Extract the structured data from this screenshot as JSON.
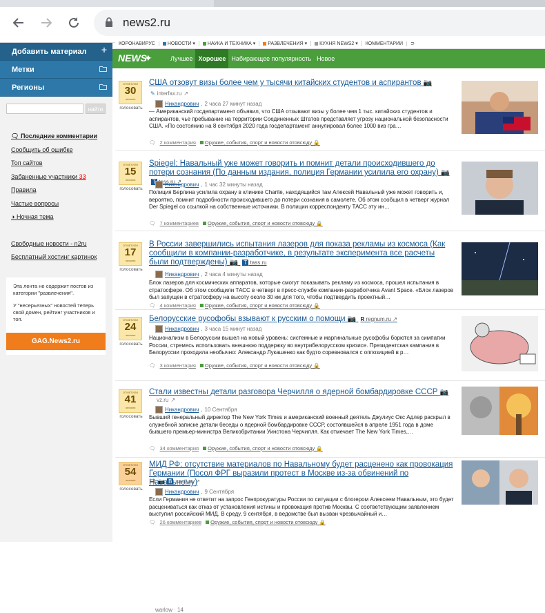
{
  "browser": {
    "url": "news2.ru"
  },
  "sidebar": {
    "add_label": "Добавить материал",
    "tags_label": "Метки",
    "regions_label": "Регионы",
    "search_button": "найти",
    "links": [
      {
        "label": "Последние комментарии"
      },
      {
        "label": "Сообщить об ошибке"
      },
      {
        "label": "Топ сайтов"
      },
      {
        "label": "Забаненные участники",
        "badge": "33"
      },
      {
        "label": "Правила"
      },
      {
        "label": "Частые вопросы"
      },
      {
        "label": "Ночная тема"
      }
    ],
    "links2": [
      {
        "label": "Свободные новости - n2ru"
      },
      {
        "label": "Бесплатный хостинг картинок"
      }
    ],
    "note1": "Эта лента не содержит постов из категории \"развлечения\".",
    "note2": "У \"несерьезных\" новостей теперь свой домен, рейтинг участников и топ.",
    "gag_label": "GAG.News2.ru"
  },
  "topnav": {
    "items": [
      "КОРОНАВИРУС",
      "НОВОСТИ ▾",
      "НАУКА И ТЕХНИКА ▾",
      "РАЗВЛЕЧЕНИЯ ▾",
      "КУХНЯ NEWS2 ▾",
      "КОММЕНТАРИИ"
    ]
  },
  "greenbar": {
    "logo": "NEWS",
    "tabs": [
      "Лучшее",
      "Хорошее",
      "Набирающее популярность",
      "Новое"
    ]
  },
  "posts": [
    {
      "votes": "30",
      "vote_top": "ОТМЕТИЛИ",
      "vote_bottom": "человек",
      "vote_label": "голосовать",
      "title": "США отзовут визы более чем у тысячи китайских студентов и аспирантов",
      "source": "interfax.ru",
      "author": "Никандрович",
      "time": "2 часа 27 минут назад",
      "body": "— Американский госдепартамент объявил, что США отзывают визы у более чем 1 тыс. китайских студентов и аспирантов, чье пребывание на территории Соединенных Штатов представляет угрозу национальной безопасности США.  «По состоянию на 8 сентября 2020 года госдепартамент аннулировал более 1000 виз гра…",
      "comments": "2 комментария",
      "tag": "Оружие, события, спорт и новости отовсюду"
    },
    {
      "votes": "15",
      "vote_top": "ОТМЕТИЛИ",
      "vote_bottom": "человек",
      "vote_label": "голосовать",
      "title": "Spiegel: Навальный уже может говорить и помнит детали происходившего до потери сознания (По данным издания, полиция Германии усилила его охрану)",
      "source": "tass.ru",
      "author": "Никандрович",
      "time": "1 час 32 минуты назад",
      "body": "Полиция Берлина усилила охрану в клинике Charite, находящийся там Алексей Навальный уже может говорить и, вероятно, помнит подробности происходившего до потери сознания в самолете. Об этом сообщил в четверг журнал Der Spiegel со ссылкой на собственные источники.  В полиции корреспонденту ТАСС эту ин…",
      "comments": "7 комментариев",
      "tag": "Оружие, события, спорт и новости отовсюду"
    },
    {
      "votes": "17",
      "vote_top": "ОТМЕТИЛИ",
      "vote_bottom": "человек",
      "vote_label": "голосовать",
      "title": "В России завершились испытания лазеров для показа рекламы из космоса (Как сообщили в компании-разработчике, в результате эксперимента все расчеты были подтверждены)",
      "source": "tass.ru",
      "author": "Никандрович",
      "time": "2 часа 4 минуты назад",
      "body": "Блок лазеров для космических аппаратов, которые смогут показывать рекламу из космоса, прошел испытания в стратосфере. Об этом сообщили ТАСС в четверг в пресс-службе компании-разработчика Avant Space.  «Блок лазеров был запущен в стратосферу на высоту около 30 км для того, чтобы подтвердить проектный…",
      "comments": "4 комментария",
      "tag": "Оружие, события, спорт и новости отовсюду"
    },
    {
      "votes": "24",
      "vote_top": "ОТМЕТИЛИ",
      "vote_bottom": "человек",
      "vote_label": "голосовать",
      "title": "Белорусские русофобы взывают к русским о помощи",
      "source": "regnum.ru",
      "author": "Никандрович",
      "time": "3 часа 15 минут назад",
      "body": "Национализм в Белоруссии вышел на новый уровень: системные и маргинальные русофобы борются за симпатии России, стремясь использовать внешнюю поддержку во внутрибелорусском кризисе.    Президентская кампания в Белоруссии проходила необычно: Александр Лукашенко как будто соревновался с оппозицией в р…",
      "comments": "3 комментария",
      "tag": "Оружие, события, спорт и новости отовсюду"
    },
    {
      "votes": "41",
      "vote_top": "ОТМЕТИЛИ",
      "vote_bottom": "человек",
      "vote_label": "голосовать",
      "title": "Стали известны детали разговора Черчилля о ядерной бомбардировке СССР",
      "source": "vz.ru",
      "author": "Никандрович",
      "time": "10 Сентября",
      "body": "Бывший генеральный директор The New York Times и американский военный деятель Джулиус Окс Адлер раскрыл в служебной записке детали беседы о ядерной бомбардировке СССР, состоявшейся в апреле 1951 года в доме бывшего премьер-министра Великобритании Уинстона Черчилля.  Как отмечает The New York Times,…",
      "comments": "34 комментария",
      "tag": "Оружие, события, спорт и новости отовсюду"
    },
    {
      "votes": "54",
      "vote_top": "ОТМЕТИЛИ",
      "vote_bottom": "человек",
      "vote_label": "голосовать",
      "title": "МИД РФ: отсутствие материалов по Навальному будет расценено как провокация Германии (Посол ФРГ выразили протест в Москве из-за обвинений по Навальному)",
      "source": "vesti.ru",
      "author": "Никандрович",
      "time": "9 Сентября",
      "body": "Если Германия не ответит на запрос Генпрокуратуры России по ситуации с блогером Алексеем Навальным, это будет расцениваться как отказ от установления истины и провокация против Москвы. С соответствующим заявлением выступил российский МИД.    В среду, 9 сентября, в ведомстве был вызван чрезвычайный и…",
      "comments": "26 комментариев",
      "tag": "Оружие, события, спорт и новости отовсюду"
    }
  ],
  "next_author": "warlow · 14"
}
